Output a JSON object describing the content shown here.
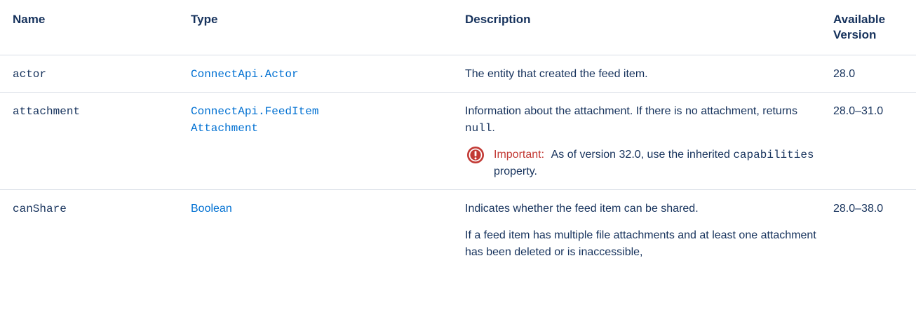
{
  "table": {
    "headers": {
      "name": "Name",
      "type": "Type",
      "description": "Description",
      "version": "Available Version"
    },
    "rows": [
      {
        "name": "actor",
        "type": "ConnectApi.Actor",
        "description": "The entity that created the feed item.",
        "version": "28.0"
      },
      {
        "name": "attachment",
        "type_line1": "ConnectApi.FeedItem",
        "type_line2": "Attachment",
        "description_before": "Information about the attachment. If there is no attachment, returns ",
        "description_code": "null",
        "description_after": ".",
        "important_label": "Important:",
        "important_before": "As of version 32.0, use the inherited ",
        "important_code": "capabilities",
        "important_after": " property.",
        "version": "28.0–31.0"
      },
      {
        "name": "canShare",
        "type": "Boolean",
        "description_p1": "Indicates whether the feed item can be shared.",
        "description_p2": "If a feed item has multiple file attachments and at least one attachment has been deleted or is inaccessible,",
        "version": "28.0–38.0"
      }
    ]
  },
  "colors": {
    "text": "#16325c",
    "link": "#0070d2",
    "important": "#c23934",
    "divider": "#d8dde6"
  },
  "icons": {
    "important": "exclamation-circle-icon"
  }
}
